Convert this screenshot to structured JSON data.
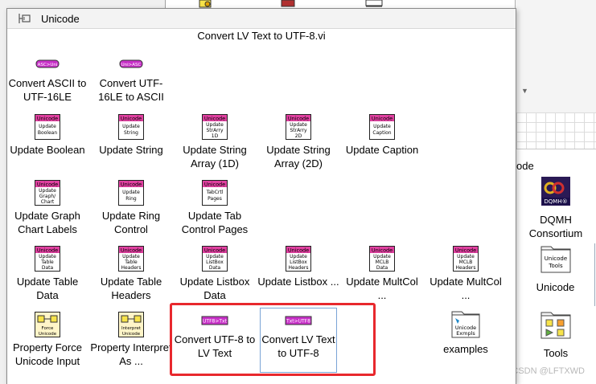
{
  "window": {
    "title": "Unicode",
    "subtitle": "Convert LV Text to UTF-8.vi"
  },
  "palette": {
    "rows": [
      [
        {
          "name": "convert-ascii-to-utf16le",
          "icon": "ascii-to-unicode-icon",
          "icon_text": "ASC>Uni",
          "label": "Convert ASCII to UTF-16LE"
        },
        {
          "name": "convert-utf16le-to-ascii",
          "icon": "unicode-to-ascii-icon",
          "icon_text": "Uni>ASC",
          "label": "Convert UTF-16LE to ASCII"
        }
      ],
      [
        {
          "name": "update-boolean",
          "icon": "unicode-update-boolean-icon",
          "icon_text": "Update Boolean",
          "label": "Update Boolean"
        },
        {
          "name": "update-string",
          "icon": "unicode-update-string-icon",
          "icon_text": "Update String",
          "label": "Update String"
        },
        {
          "name": "update-string-array-1d",
          "icon": "unicode-update-strarray-1d-icon",
          "icon_text": "Update StrArry 1D",
          "label": "Update String Array (1D)"
        },
        {
          "name": "update-string-array-2d",
          "icon": "unicode-update-strarray-2d-icon",
          "icon_text": "Update StrArry 2D",
          "label": "Update String Array (2D)"
        },
        {
          "name": "update-caption",
          "icon": "unicode-update-caption-icon",
          "icon_text": "Update Caption",
          "label": "Update Caption"
        }
      ],
      [
        {
          "name": "update-graph-chart-labels",
          "icon": "unicode-update-graph-icon",
          "icon_text": "Update Graph/ Chart",
          "label": "Update Graph Chart Labels"
        },
        {
          "name": "update-ring-control",
          "icon": "unicode-update-ring-icon",
          "icon_text": "Update Ring",
          "label": "Update Ring Control"
        },
        {
          "name": "update-tab-control-pages",
          "icon": "unicode-tabctrl-pages-icon",
          "icon_text": "TabCrtl Pages",
          "label": "Update Tab Control Pages"
        }
      ],
      [
        {
          "name": "update-table-data",
          "icon": "unicode-update-table-data-icon",
          "icon_text": "Update Table Data",
          "label": "Update Table Data"
        },
        {
          "name": "update-table-headers",
          "icon": "unicode-update-table-headers-icon",
          "icon_text": "Update Table Headers",
          "label": "Update Table Headers"
        },
        {
          "name": "update-listbox-data",
          "icon": "unicode-update-listbox-data-icon",
          "icon_text": "Update ListBox Data",
          "label": "Update Listbox Data"
        },
        {
          "name": "update-listbox-headers",
          "icon": "unicode-update-listbox-headers-icon",
          "icon_text": "Update ListBox Headers",
          "label": "Update Listbox ..."
        },
        {
          "name": "update-multcol-data",
          "icon": "unicode-update-mclb-data-icon",
          "icon_text": "Update MCLB Data",
          "label": "Update MultCol ..."
        },
        {
          "name": "update-multcol-headers",
          "icon": "unicode-update-mclb-headers-icon",
          "icon_text": "Update MCLB Headers",
          "label": "Update MultCol ..."
        }
      ],
      [
        {
          "name": "property-force-unicode-input",
          "icon": "force-unicode-icon",
          "icon_text": "Force Unicode",
          "label": "Property Force Unicode Input"
        },
        {
          "name": "property-interpret-as",
          "icon": "interpret-unicode-icon",
          "icon_text": "Interpret Unicode",
          "label": "Property Interpret As ..."
        },
        {
          "name": "convert-utf8-to-lv-text",
          "icon": "utf8-to-text-icon",
          "icon_text": "UTF8>Txt",
          "label": "Convert UTF-8 to LV Text"
        },
        {
          "name": "convert-lv-text-to-utf8",
          "icon": "text-to-utf8-icon",
          "icon_text": "Txt>UTF8",
          "label": "Convert LV Text to UTF-8"
        },
        {
          "name": "examples",
          "icon": "unicode-examples-folder-icon",
          "icon_text": "Unicode Exmpls",
          "label": "examples"
        }
      ]
    ]
  },
  "background": {
    "section_label_fragment": "ode",
    "items": [
      {
        "name": "dqmh-consortium",
        "icon": "dqmh-logo-icon",
        "icon_text": "DQMH®",
        "label": "DQMH Consortium"
      },
      {
        "name": "unicode-folder",
        "icon": "unicode-tools-folder-icon",
        "icon_text": "Unicode Tools",
        "label": "Unicode"
      },
      {
        "name": "tools-folder",
        "icon": "tools-folder-icon",
        "icon_text": "",
        "label": "Tools"
      }
    ],
    "watermark": "CSDN @LFTXWD"
  },
  "colors": {
    "unicode_header": "#e040a0",
    "convert_pill": "#c830c8",
    "highlight": "#e8282d",
    "selection_border": "#7aa4d6"
  }
}
